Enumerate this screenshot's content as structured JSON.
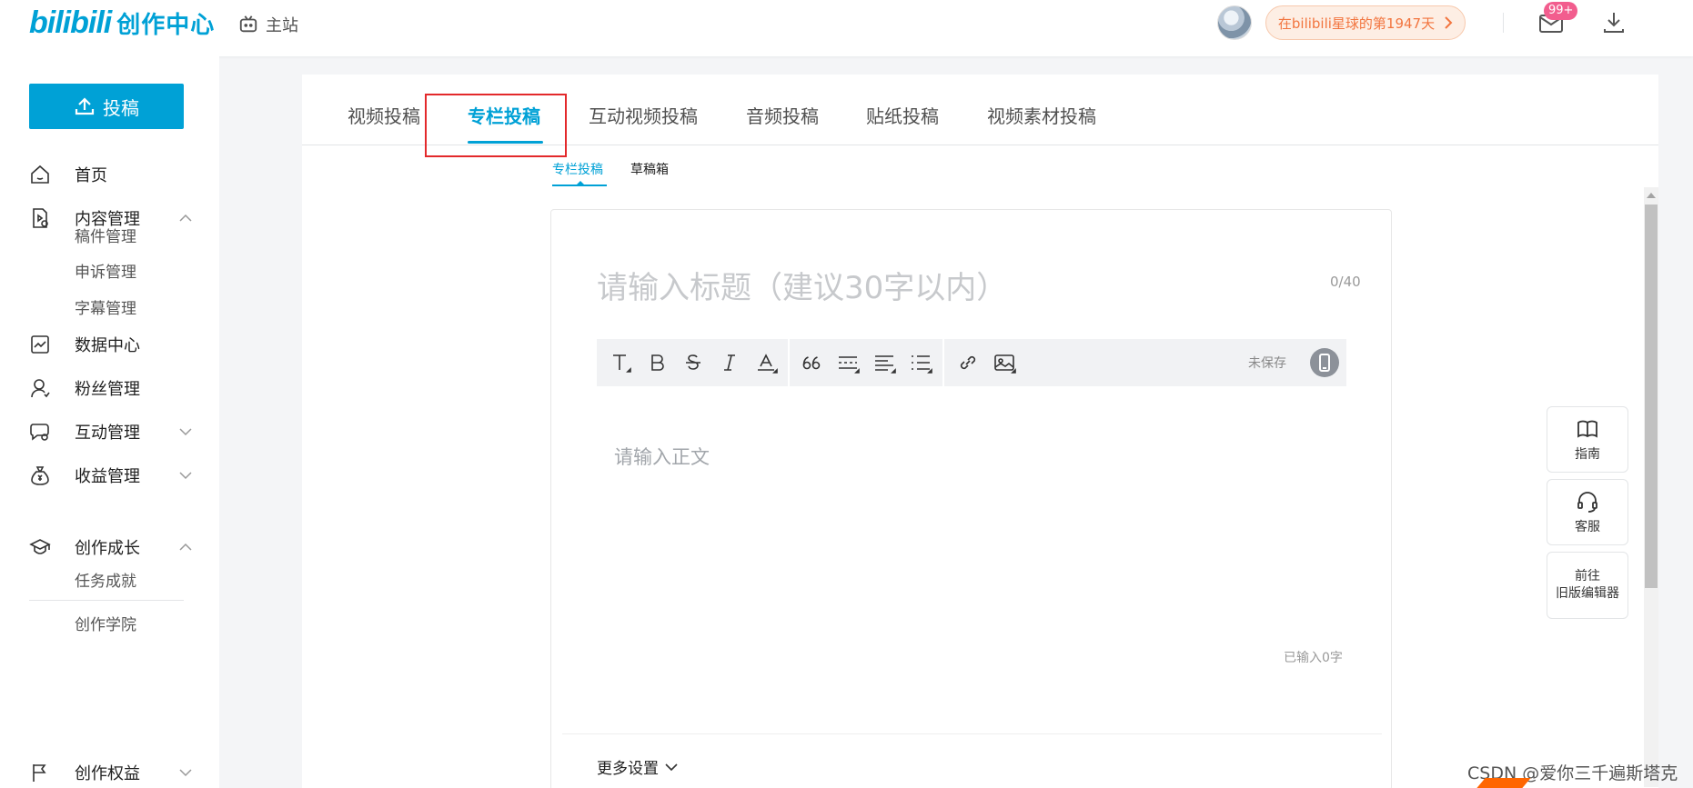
{
  "header": {
    "logo_brand": "bilibili",
    "logo_sub": "创作中心",
    "home_label": "主站",
    "days_text": "在bilibili星球的第1947天",
    "mail_badge": "99+"
  },
  "sidebar": {
    "upload_label": "投稿",
    "items": [
      {
        "label": "首页",
        "icon": "home-icon"
      },
      {
        "label": "内容管理",
        "icon": "content-icon",
        "expanded": true
      },
      {
        "label": "数据中心",
        "icon": "chart-icon"
      },
      {
        "label": "粉丝管理",
        "icon": "user-icon"
      },
      {
        "label": "互动管理",
        "icon": "chat-icon",
        "expanded": false
      },
      {
        "label": "收益管理",
        "icon": "money-bag-icon",
        "expanded": false
      },
      {
        "label": "创作成长",
        "icon": "graduation-icon",
        "expanded": true
      },
      {
        "label": "创作权益",
        "icon": "flag-icon",
        "expanded": false
      }
    ],
    "content_sub": [
      "稿件管理",
      "申诉管理",
      "字幕管理"
    ],
    "growth_sub": [
      "任务成就",
      "创作学院"
    ]
  },
  "tabs": [
    "视频投稿",
    "专栏投稿",
    "互动视频投稿",
    "音频投稿",
    "贴纸投稿",
    "视频素材投稿"
  ],
  "active_tab": "专栏投稿",
  "subtabs": [
    "专栏投稿",
    "草稿箱"
  ],
  "editor": {
    "title_placeholder": "请输入标题（建议30字以内）",
    "title_count": "0/40",
    "save_status": "未保存",
    "body_placeholder": "请输入正文",
    "word_count": "已输入0字",
    "more_settings": "更多设置"
  },
  "float": {
    "guide": "指南",
    "service": "客服",
    "old_editor_line1": "前往",
    "old_editor_line2": "旧版编辑器"
  },
  "watermark": "CSDN @爱你三千遍斯塔克",
  "colors": {
    "accent": "#00a1d6",
    "highlight_box": "#e3292b",
    "badge": "#f25d8e",
    "pill_text": "#f2753f"
  }
}
